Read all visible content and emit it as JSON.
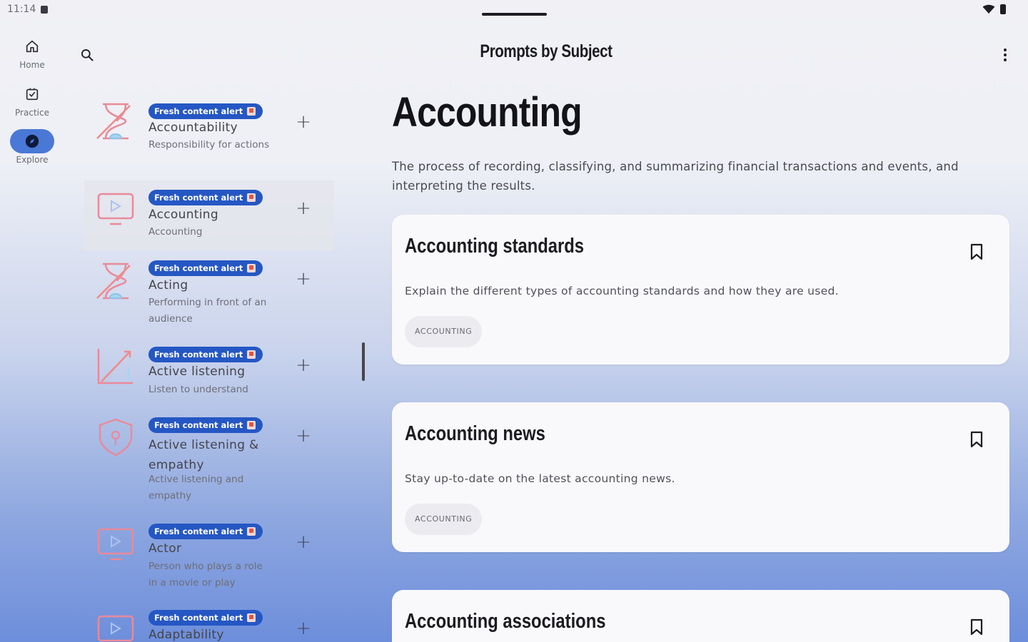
{
  "status": {
    "time": "11:14"
  },
  "rail": {
    "items": [
      {
        "label": "Home",
        "icon": "home-icon"
      },
      {
        "label": "Practice",
        "icon": "checklist-icon"
      },
      {
        "label": "Explore",
        "icon": "compass-icon"
      }
    ],
    "active": "Explore"
  },
  "topbar": {
    "title": "Prompts by Subject"
  },
  "list": {
    "badge_text": "Fresh content alert",
    "items": [
      {
        "name": "Accountability",
        "subtitle": "Responsibility for actions",
        "icon": "hourglass-icon"
      },
      {
        "name": "Accounting",
        "subtitle": "Accounting",
        "icon": "monitor-play-icon"
      },
      {
        "name": "Acting",
        "subtitle": "Performing in front of an audience",
        "icon": "hourglass-icon"
      },
      {
        "name": "Active listening",
        "subtitle": "Listen to understand",
        "icon": "chart-up-icon"
      },
      {
        "name": "Active listening & empathy",
        "subtitle": "Active listening and empathy",
        "icon": "shield-icon"
      },
      {
        "name": "Actor",
        "subtitle": "Person who plays a role in a movie or play",
        "icon": "monitor-play-icon"
      },
      {
        "name": "Adaptability",
        "subtitle": "",
        "icon": "monitor-play-icon"
      }
    ]
  },
  "detail": {
    "title": "Accounting",
    "description": "The process of recording, classifying, and summarizing financial transactions and events, and interpreting the results.",
    "cards": [
      {
        "title": "Accounting standards",
        "description": "Explain the different types of accounting standards and how they are used.",
        "tag": "ACCOUNTING"
      },
      {
        "title": "Accounting news",
        "description": "Stay up-to-date on the latest accounting news.",
        "tag": "ACCOUNTING"
      },
      {
        "title": "Accounting associations",
        "description": "",
        "tag": ""
      }
    ]
  },
  "colors": {
    "accent": "#2557c4",
    "rail_active": "#4a78d6",
    "icon_pink": "#e98a9a",
    "icon_blue": "#8cc4e8"
  }
}
